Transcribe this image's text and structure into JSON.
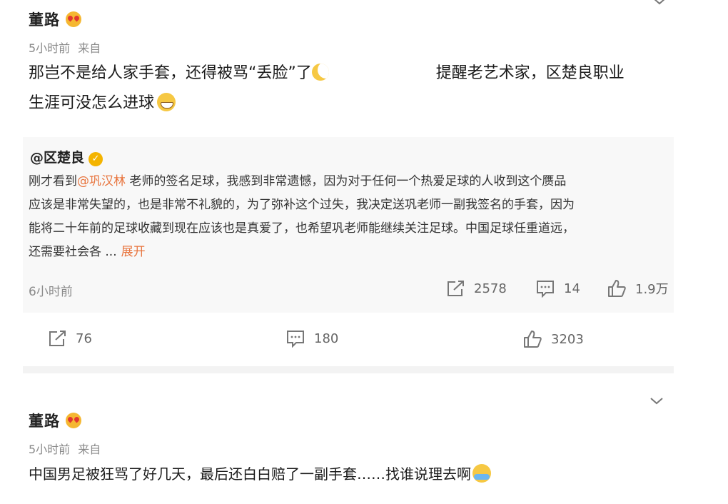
{
  "comments": [
    {
      "author": "董路",
      "time": "5小时前",
      "source": "来自",
      "text_part1": "那岂不是给人家手套，还得被骂“丢脸”了",
      "text_part2": "提醒老艺术家，区楚良职业",
      "text_part3": "生涯可没怎么进球",
      "repost": {
        "author": "@区楚良",
        "text_before_mention": "刚才看到",
        "mention": "@巩汉林",
        "text_line1_rest": " 老师的签名足球，我感到非常遗憾，因为对于任何一个热爱足球的人收到这个赝品",
        "text_line2": "应该是非常失望的，也是非常不礼貌的，为了弥补这个过失，我决定送巩老师一副我签名的手套，因为",
        "text_line3": "能将二十年前的足球收藏到现在应该也是真爱了，也希望巩老师能继续关注足球。中国足球任重道远，",
        "text_line4": "还需要社会各  ...",
        "expand_label": "展开",
        "time": "6小时前",
        "stats": {
          "reposts": "2578",
          "comments": "14",
          "likes": "1.9万"
        }
      },
      "stats": {
        "reposts": "76",
        "comments": "180",
        "likes": "3203"
      }
    },
    {
      "author": "董路",
      "time": "5小时前",
      "source": "来自",
      "text": "中国男足被狂骂了好几天，最后还白白赔了一副手套……找谁说理去啊"
    }
  ],
  "icons": [
    "heart-eyes-emoji-icon",
    "moon-emoji-icon",
    "grin-emoji-icon",
    "verified-badge-icon",
    "repost-icon",
    "comment-icon",
    "like-icon",
    "chevron-down-icon",
    "cry-emoji-icon"
  ],
  "colors": {
    "mention": "#e8743d",
    "verified": "#f4b400",
    "meta": "#8a8a8a"
  }
}
